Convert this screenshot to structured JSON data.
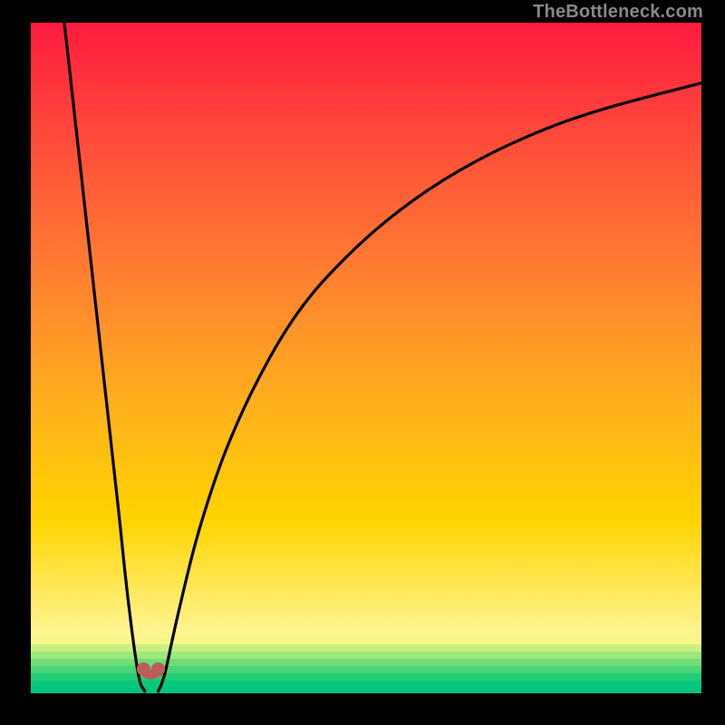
{
  "watermark": "TheBottleneck.com",
  "chart_data": {
    "type": "line",
    "title": "",
    "xlabel": "",
    "ylabel": "",
    "xlim": [
      0,
      100
    ],
    "ylim": [
      0,
      100
    ],
    "legend": false,
    "grid": false,
    "series": [
      {
        "name": "left-branch",
        "x": [
          5,
          7,
          9,
          11,
          13,
          14.5,
          16,
          17
        ],
        "y": [
          100,
          82,
          64,
          46,
          28,
          14,
          3,
          0.3
        ]
      },
      {
        "name": "right-branch",
        "x": [
          19,
          20,
          22,
          25,
          29,
          34,
          40,
          47,
          55,
          64,
          74,
          85,
          100
        ],
        "y": [
          0.3,
          3,
          12,
          24,
          36,
          47,
          57,
          65,
          72,
          78,
          83,
          87,
          91
        ]
      }
    ],
    "markers": [
      {
        "x": 16.8,
        "y": 3.6
      },
      {
        "x": 19.0,
        "y": 3.6
      }
    ],
    "bottom_gradient": {
      "y_start": 0,
      "y_end": 9.5,
      "colors_top_to_bottom": [
        "#fff48f",
        "#f5f788",
        "#c8f07e",
        "#9de87a",
        "#6fde78",
        "#48d477",
        "#23cd78",
        "#07c97c",
        "#00c480"
      ]
    },
    "main_gradient": {
      "y_top": 100,
      "y_bottom": 9.5,
      "colors_top_to_bottom": [
        "#ff1b3f",
        "#ff4d3a",
        "#ff8030",
        "#ffb01c",
        "#ffd400",
        "#fff48f"
      ]
    }
  }
}
